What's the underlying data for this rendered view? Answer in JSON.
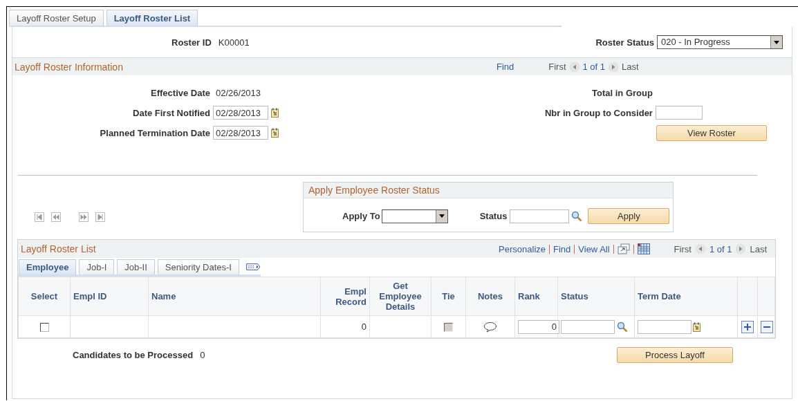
{
  "tabs": [
    {
      "label": "Layoff Roster Setup",
      "selected": false
    },
    {
      "label": "Layoff Roster List",
      "selected": true
    }
  ],
  "roster_id": {
    "label": "Roster ID",
    "value": "K00001"
  },
  "roster_status": {
    "label": "Roster Status",
    "value": "020 - In Progress"
  },
  "info_section": {
    "title": "Layoff Roster Information",
    "find": "Find",
    "first": "First",
    "count": "1 of 1",
    "last": "Last",
    "effective_date": {
      "label": "Effective Date",
      "value": "02/26/2013"
    },
    "date_first_notified": {
      "label": "Date First Notified",
      "value": "02/28/2013"
    },
    "planned_termination_date": {
      "label": "Planned Termination Date",
      "value": "02/28/2013"
    },
    "total_in_group": {
      "label": "Total in Group"
    },
    "nbr_in_group": {
      "label": "Nbr in Group to Consider"
    },
    "view_roster_button": "View Roster"
  },
  "apply_status": {
    "title": "Apply Employee Roster Status",
    "apply_to_label": "Apply To",
    "status_label": "Status",
    "apply_button": "Apply"
  },
  "roster_list": {
    "title": "Layoff Roster List",
    "links": [
      "Personalize",
      "Find",
      "View All"
    ],
    "first": "First",
    "count": "1 of 1",
    "last": "Last",
    "tabs": [
      {
        "label": "Employee",
        "selected": true
      },
      {
        "label": "Job-I",
        "selected": false
      },
      {
        "label": "Job-II",
        "selected": false
      },
      {
        "label": "Seniority Dates-I",
        "selected": false
      }
    ],
    "columns": [
      "Select",
      "Empl ID",
      "Name",
      "Empl Record",
      "Get Employee Details",
      "Tie",
      "Notes",
      "Rank",
      "Status",
      "Term Date"
    ],
    "rows": [
      {
        "select_checked": false,
        "empl_record": "0",
        "tie_checked": false,
        "rank": "0"
      }
    ]
  },
  "candidates": {
    "label": "Candidates to be Processed",
    "value": "0"
  },
  "process_button": "Process Layoff"
}
